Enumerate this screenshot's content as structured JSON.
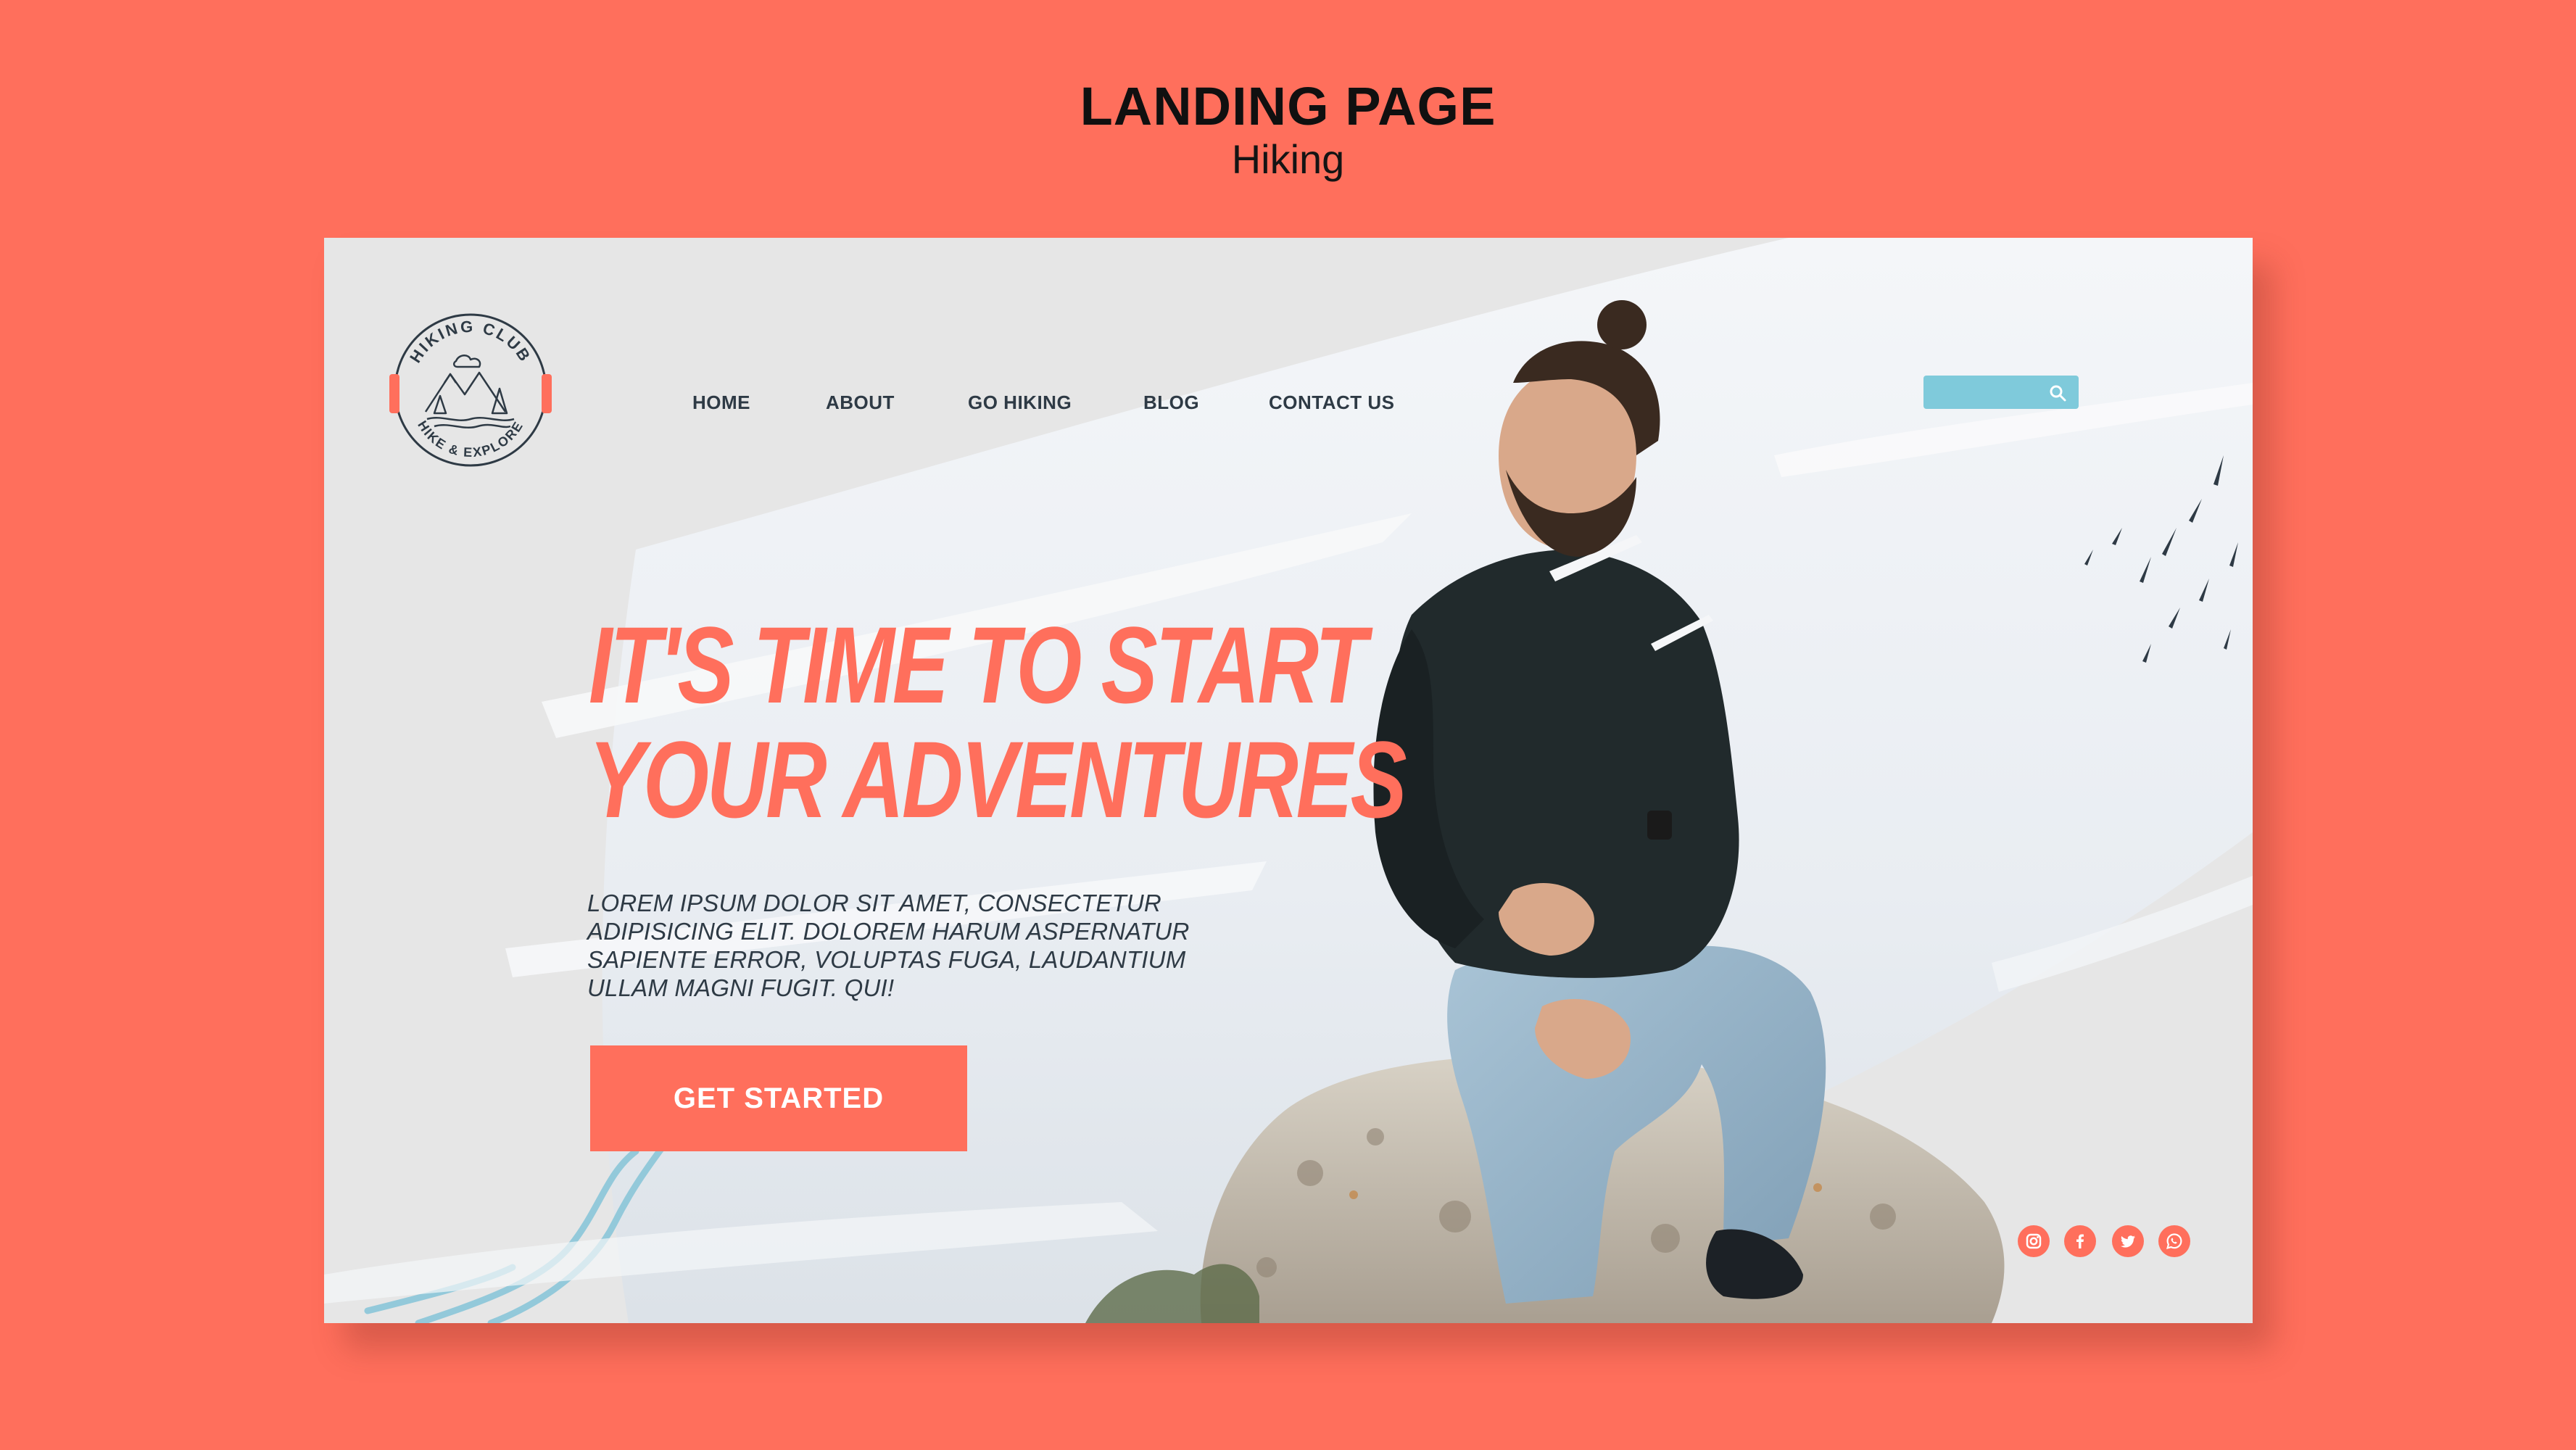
{
  "page_heading": {
    "title": "LANDING PAGE",
    "subtitle": "Hiking"
  },
  "logo": {
    "top_text": "HIKING CLUB",
    "bottom_text": "HIKE & EXPLORE"
  },
  "nav": {
    "items": [
      {
        "label": "HOME"
      },
      {
        "label": "ABOUT"
      },
      {
        "label": "GO HIKING"
      },
      {
        "label": "BLOG"
      },
      {
        "label": "CONTACT US"
      }
    ]
  },
  "search": {
    "placeholder": "",
    "icon": "search-icon"
  },
  "hero": {
    "headline_line1": "IT'S TIME TO START",
    "headline_line2": "YOUR ADVENTURES",
    "body": "LOREM IPSUM DOLOR SIT AMET, CONSECTETUR ADIPISICING ELIT. DOLOREM HARUM ASPERNATUR SAPIENTE ERROR, VOLUPTAS FUGA, LAUDANTIUM ULLAM MAGNI FUGIT. QUI!",
    "cta_label": "GET STARTED"
  },
  "social": [
    {
      "icon": "instagram-icon"
    },
    {
      "icon": "facebook-icon"
    },
    {
      "icon": "twitter-icon"
    },
    {
      "icon": "whatsapp-icon"
    }
  ],
  "colors": {
    "background": "#FF6F5C",
    "accent": "#FF6F5C",
    "card": "#E6E6E6",
    "nav_text": "#2E3A45",
    "search": "#7FCADB"
  }
}
